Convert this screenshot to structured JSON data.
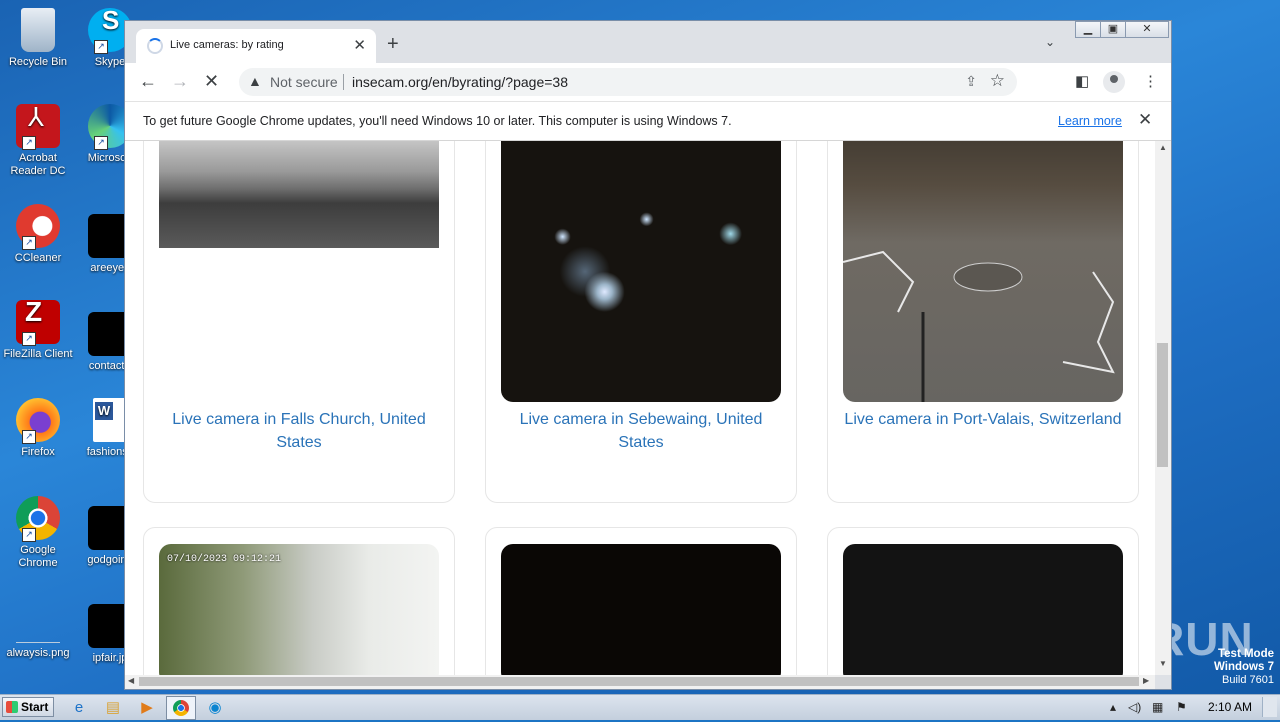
{
  "desktop": {
    "icons": [
      {
        "label": "Recycle Bin",
        "name": "recycle-bin-icon"
      },
      {
        "label": "Skype",
        "name": "skype-icon"
      },
      {
        "label": "Acrobat Reader DC",
        "name": "acrobat-reader-icon"
      },
      {
        "label": "Microsoft",
        "name": "microsoft-edge-icon"
      },
      {
        "label": "CCleaner",
        "name": "ccleaner-icon"
      },
      {
        "label": "areeyes",
        "name": "file-icon"
      },
      {
        "label": "FileZilla Client",
        "name": "filezilla-icon"
      },
      {
        "label": "contactfr",
        "name": "file-icon"
      },
      {
        "label": "Firefox",
        "name": "firefox-icon"
      },
      {
        "label": "fashionsy",
        "name": "word-document-icon"
      },
      {
        "label": "Google Chrome",
        "name": "chrome-icon"
      },
      {
        "label": "godgoing",
        "name": "file-icon"
      },
      {
        "label": "alwaysis.png",
        "name": "image-file-icon"
      },
      {
        "label": "ipfair.jp",
        "name": "file-icon"
      }
    ],
    "watermark": "ANY RUN",
    "test_mode": {
      "line1": "Test Mode",
      "line2": "Windows 7",
      "line3": "Build 7601"
    }
  },
  "browser": {
    "tab_title": "Live cameras: by rating",
    "new_tab": "+",
    "tab_close": "✕",
    "security_label": "Not secure",
    "url": "insecam.org/en/byrating/?page=38",
    "infobar": {
      "message": "To get future Google Chrome updates, you'll need Windows 10 or later. This computer is using Windows 7.",
      "link": "Learn more"
    }
  },
  "cameras": [
    {
      "caption": "Live camera in Falls Church, United States"
    },
    {
      "caption": "Live camera in Sebewaing, United States"
    },
    {
      "caption": "Live camera in Port-Valais, Switzerland"
    },
    {
      "caption": "",
      "overlay": "07/10/2023 09:12:21"
    },
    {
      "caption": ""
    },
    {
      "caption": ""
    }
  ],
  "taskbar": {
    "start_label": "Start",
    "clock": "2:10 AM"
  }
}
